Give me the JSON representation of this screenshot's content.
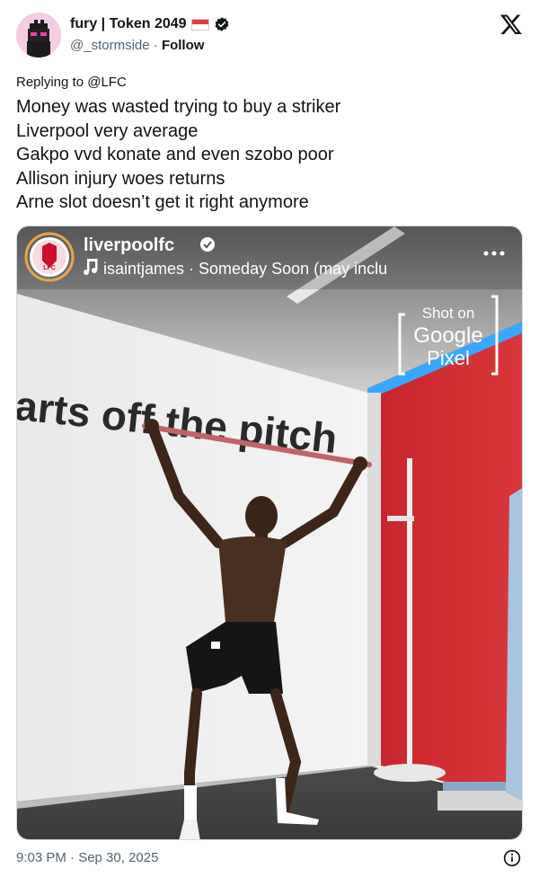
{
  "author": {
    "display_name": "fury | Token 2049",
    "handle": "@_stormside",
    "separator": "·",
    "follow_label": "Follow",
    "verified": true
  },
  "reply_context": "Replying to @LFC",
  "tweet_lines": [
    "Money was wasted trying to buy a striker",
    "Liverpool very average",
    "Gakpo vvd konate and even szobo poor",
    "Allison injury woes returns",
    "Arne slot doesn’t get it right anymore"
  ],
  "media": {
    "ig_account": "liverpoolfc",
    "ig_audio": "isaintjames · Someday Soon (may inclu",
    "watermark_line1": "Shot on",
    "watermark_line2": "Google",
    "watermark_line3": "Pixel",
    "wall_text": "arts off the pitch",
    "badge_text": "LFC"
  },
  "footer": {
    "timestamp": "9:03 PM · Sep 30, 2025"
  },
  "colors": {
    "accent_red": "#d22630",
    "muted": "#536471",
    "text": "#0f1419"
  }
}
